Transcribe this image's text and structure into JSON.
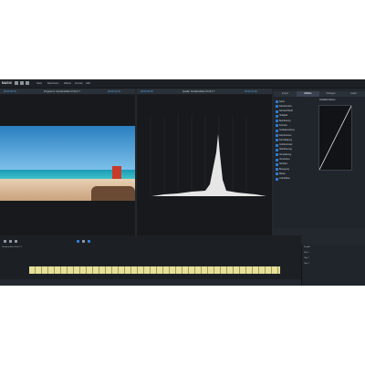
{
  "app": {
    "logo": "MAGIX",
    "menu_items": [
      "Datei",
      "Bearbeiten",
      "Effekte",
      "Fenster",
      "Hilfe"
    ]
  },
  "left_monitor": {
    "title": "Programm: Sonderedition Profi 2 7",
    "time_left": "00:00:00:00",
    "time_right": "00:00:12:03"
  },
  "right_monitor": {
    "title": "Quelle: Sonderedition Profi 2 7",
    "time_left": "00:00:00:00",
    "time_right": "00:00:12:03"
  },
  "right_panel": {
    "tabs": [
      "Import",
      "Effekte",
      "Vorlagen",
      "Audio"
    ],
    "effects": [
      "Farbe",
      "Farbkorrektur",
      "Schwarz/Weiß",
      "Helligkeit",
      "Bearbeitung",
      "Kontrast",
      "Gradationskurve",
      "Farbtonkurve",
      "Farbsättigung",
      "Colorkorrektur",
      "Stabilisierung",
      "Verwacklung",
      "Verwischen",
      "Schärfen",
      "Bewegung",
      "Maske",
      "Lichteffekte"
    ],
    "curve_title": "Gradationskurve"
  },
  "timeline": {
    "track_label": "Sonderedition Profi 2 7",
    "footer_rows": [
      "Projekt",
      "Clip 1",
      "Clip 2",
      "Clip 3"
    ]
  },
  "colors": {
    "accent": "#2f7fd8",
    "time_text": "#4ea3e6"
  }
}
